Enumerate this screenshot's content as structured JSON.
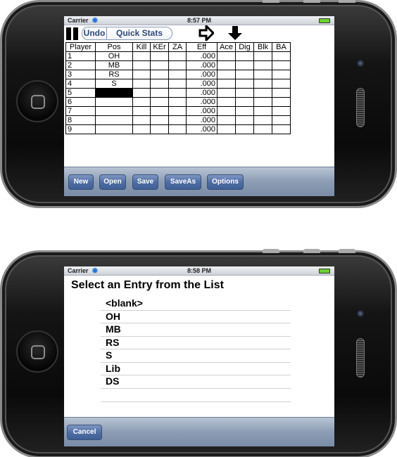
{
  "screen1": {
    "status": {
      "carrier": "Carrier",
      "time": "8:57 PM"
    },
    "toolbar": {
      "undo_label": "Undo",
      "quick_stats_label": "Quick Stats"
    },
    "table": {
      "headers": [
        "Player",
        "Pos",
        "Kill",
        "KEr",
        "ZA",
        "Eff",
        "Ace",
        "Dig",
        "Blk",
        "BA"
      ],
      "rows": [
        {
          "player": "1",
          "pos": "OH",
          "eff": ".000"
        },
        {
          "player": "2",
          "pos": "MB",
          "eff": ".000"
        },
        {
          "player": "3",
          "pos": "RS",
          "eff": ".000"
        },
        {
          "player": "4",
          "pos": "S",
          "eff": ".000"
        },
        {
          "player": "5",
          "pos": "",
          "eff": ".000"
        },
        {
          "player": "6",
          "pos": "",
          "eff": ".000"
        },
        {
          "player": "7",
          "pos": "",
          "eff": ".000"
        },
        {
          "player": "8",
          "pos": "",
          "eff": ".000"
        },
        {
          "player": "9",
          "pos": "",
          "eff": ".000"
        }
      ]
    },
    "bottom_buttons": [
      "New",
      "Open",
      "Save",
      "SaveAs",
      "Options"
    ]
  },
  "screen2": {
    "status": {
      "carrier": "Carrier",
      "time": "8:58 PM"
    },
    "title": "Select an Entry from the List",
    "entries": [
      "<blank>",
      "OH",
      "MB",
      "RS",
      "S",
      "Lib",
      "DS"
    ],
    "cancel_label": "Cancel"
  },
  "icons": {
    "pause": "pause-icon",
    "wifi": "wifi-icon",
    "battery": "battery-icon",
    "next": "arrow-right-icon",
    "down": "arrow-down-icon",
    "home": "home-button-icon"
  },
  "colors": {
    "toolbar_button": "#4f6ea3",
    "segment_text": "#2c4a7b",
    "battery": "#6ad12a",
    "selected_cell": "#000000"
  }
}
